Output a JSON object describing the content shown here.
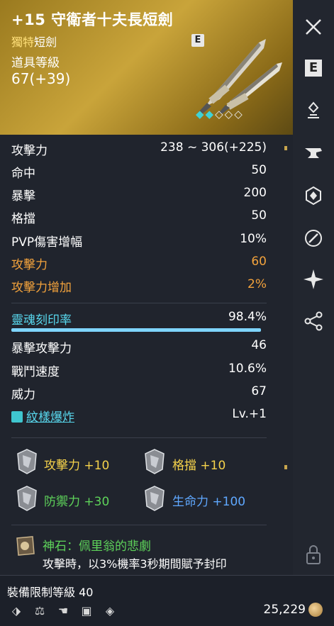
{
  "header": {
    "title": "+15 守衛者十夫長短劍",
    "rarity": "獨特",
    "weapon_type": "短劍",
    "item_level_label": "道具等級",
    "item_level_value": "67(+39)",
    "grade_badge": "E",
    "enchant_diamonds": {
      "filled": 2,
      "total": 6
    }
  },
  "stats": [
    {
      "label": "攻擊力",
      "value": "238 ~ 306(+225)"
    },
    {
      "label": "命中",
      "value": "50"
    },
    {
      "label": "暴擊",
      "value": "200"
    },
    {
      "label": "格擋",
      "value": "50"
    },
    {
      "label": "PVP傷害增幅",
      "value": "10%"
    },
    {
      "label": "攻擊力",
      "value": "60"
    },
    {
      "label": "攻擊力增加",
      "value": "2%"
    }
  ],
  "soul": {
    "label": "靈魂刻印率",
    "value": "98.4%"
  },
  "soul_stats": [
    {
      "label": "暴擊攻擊力",
      "value": "46"
    },
    {
      "label": "戰鬥速度",
      "value": "10.6%"
    },
    {
      "label": "威力",
      "value": "67"
    }
  ],
  "pattern": {
    "label": "紋樣爆炸",
    "value": "Lv.+1"
  },
  "manastones": [
    {
      "text": "攻擊力 +10"
    },
    {
      "text": "格擋 +10"
    },
    {
      "text": "防禦力 +30"
    },
    {
      "text": "生命力 +100"
    }
  ],
  "godstone": {
    "name": "神石：佩里翁的悲劇",
    "desc": "攻擊時，以3%機率3秒期間賦予封印"
  },
  "footer": {
    "level_limit": "裝備限制等級 40",
    "gold": "25,229"
  },
  "colors": {
    "gold_header": "#c9a43a",
    "orange": "#f2a23c",
    "cyan": "#58d8ee",
    "green": "#5ed35a",
    "yellow": "#f5d24b",
    "blue": "#5fa8ff"
  },
  "side_icons": [
    "close-icon",
    "enchant-e-icon",
    "altar-icon",
    "anvil-icon",
    "crystal-icon",
    "link-icon",
    "star-burst-icon",
    "share-icon",
    "lock-icon"
  ]
}
